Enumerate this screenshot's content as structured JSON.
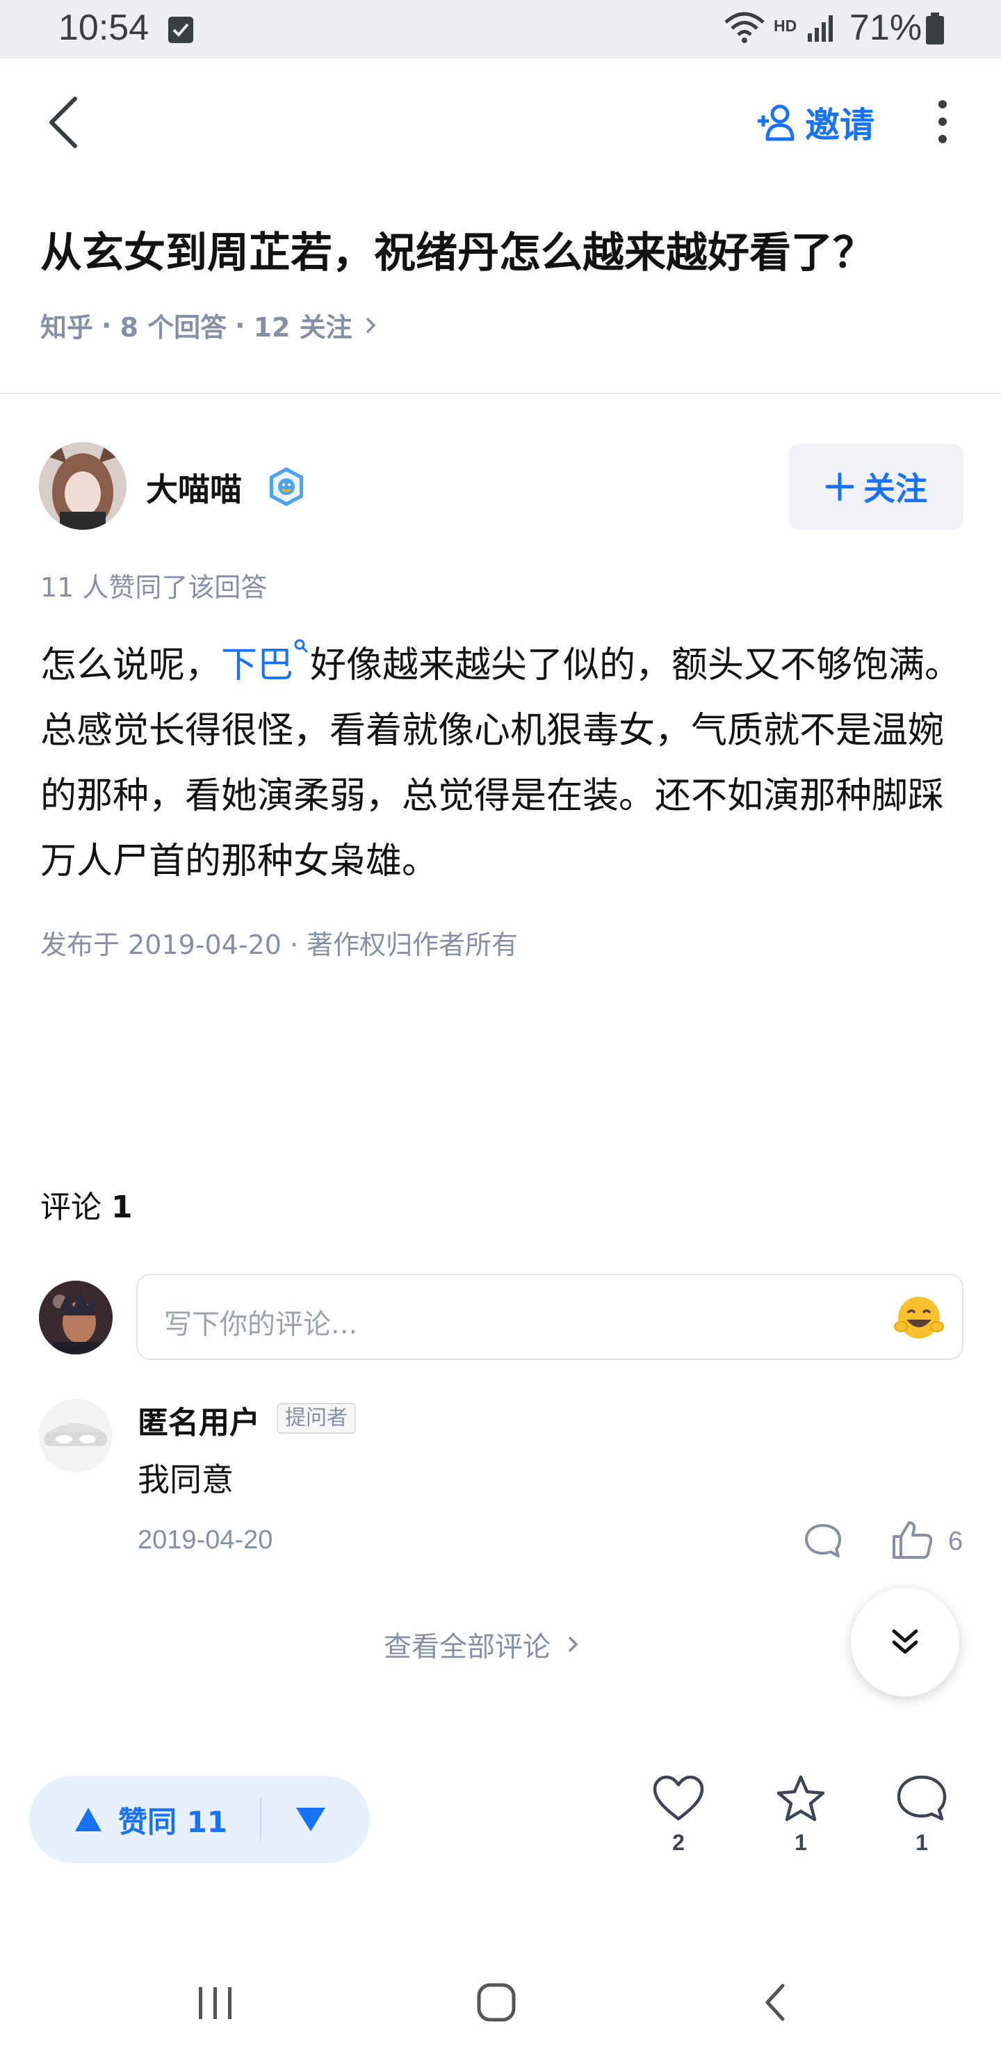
{
  "status_bar": {
    "time": "10:54",
    "network_label": "HD",
    "battery_percent": "71%"
  },
  "header": {
    "invite_label": "邀请"
  },
  "question": {
    "title": "从玄女到周芷若，祝绪丹怎么越来越好看了？",
    "source": "知乎",
    "answers": "8 个回答",
    "follows": "12 关注",
    "sep": "·"
  },
  "author": {
    "name": "大喵喵",
    "follow_label": "关注"
  },
  "answer": {
    "vote_summary": "11 人赞同了该回答",
    "text_before_link": "怎么说呢，",
    "link_text": "下巴",
    "text_after_link": "好像越来越尖了似的，额头又不够饱满。总感觉长得很怪，看着就像心机狠毒女，气质就不是温婉的那种，看她演柔弱，总觉得是在装。还不如演那种脚踩万人尸首的那种女枭雄。",
    "publish_info": "发布于 2019-04-20 · 著作权归作者所有"
  },
  "comments": {
    "heading": "评论",
    "count": "1",
    "input_placeholder": "写下你的评论...",
    "items": [
      {
        "author": "匿名用户",
        "badge": "提问者",
        "text": "我同意",
        "date": "2019-04-20",
        "likes": "6"
      }
    ],
    "view_all_label": "查看全部评论"
  },
  "action_bar": {
    "upvote_label": "赞同 11",
    "likes": "2",
    "favorites": "1",
    "comments": "1"
  },
  "colors": {
    "accent": "#1772f6",
    "meta_gray": "#8590a6",
    "pill_bg": "#e8f0fd"
  }
}
